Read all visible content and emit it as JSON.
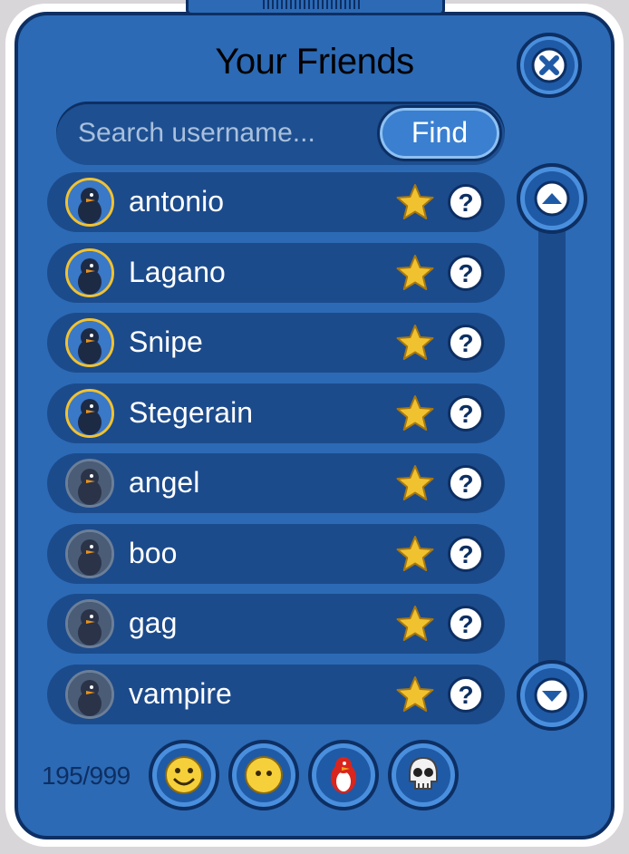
{
  "window": {
    "title": "Your Friends"
  },
  "search": {
    "placeholder": "Search username...",
    "find_label": "Find"
  },
  "friends": [
    {
      "name": "antonio",
      "status": "online"
    },
    {
      "name": "Lagano",
      "status": "online"
    },
    {
      "name": "Snipe",
      "status": "online"
    },
    {
      "name": "Stegerain",
      "status": "online"
    },
    {
      "name": "angel",
      "status": "offline"
    },
    {
      "name": "boo",
      "status": "offline"
    },
    {
      "name": "gag",
      "status": "offline"
    },
    {
      "name": "vampire",
      "status": "offline"
    }
  ],
  "footer": {
    "count": "195/999",
    "filters": [
      "smiley-icon",
      "neutral-face-icon",
      "penguin-icon",
      "skull-icon"
    ]
  },
  "icons": {
    "close": "close-icon",
    "scroll_up": "chevron-up-icon",
    "scroll_down": "chevron-down-icon",
    "favorite": "star-icon",
    "info": "question-icon"
  },
  "colors": {
    "panel": "#2c6ab5",
    "row": "#1c4b8c",
    "border": "#0d2f63",
    "star": "#f1c230",
    "online_ring": "#f1c230",
    "offline_ring": "#6c7f98"
  }
}
